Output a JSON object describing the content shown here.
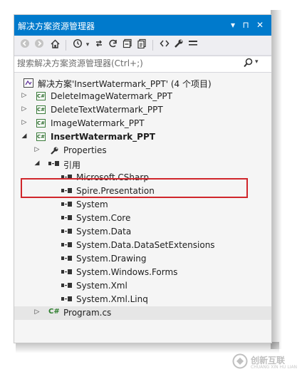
{
  "panel": {
    "title": "解决方案资源管理器",
    "title_buttons": [
      "▾",
      "⊓",
      "✕"
    ]
  },
  "toolbar": {
    "icons": [
      "back-icon",
      "forward-icon",
      "home-icon",
      "history-icon",
      "sync-icon",
      "refresh-icon",
      "collapse-all-icon",
      "show-all-files-icon",
      "view-code-icon",
      "properties-icon",
      "preview-icon"
    ]
  },
  "search": {
    "placeholder": "搜索解决方案资源管理器(Ctrl+;)"
  },
  "tree": {
    "solution": "解决方案'InsertWatermark_PPT' (4 个项目)",
    "projects": [
      {
        "label": "DeleteImageWatermark_PPT"
      },
      {
        "label": "DeleteTextWatermark_PPT"
      },
      {
        "label": "ImageWatermark_PPT"
      },
      {
        "label": "InsertWatermark_PPT"
      }
    ],
    "properties": "Properties",
    "references_label": "引用",
    "references": [
      "Microsoft.CSharp",
      "Spire.Presentation",
      "System",
      "System.Core",
      "System.Data",
      "System.Data.DataSetExtensions",
      "System.Drawing",
      "System.Windows.Forms",
      "System.Xml",
      "System.Xml.Linq"
    ],
    "program": "Program.cs",
    "cs_badge": "C#"
  },
  "watermark": {
    "text": "创新互联",
    "sub": "CHUANG XIN HU LIAN"
  },
  "colors": {
    "title_bar": "#007acc",
    "highlight_box": "#d0262b",
    "selected_row": "#e6e6e6"
  }
}
